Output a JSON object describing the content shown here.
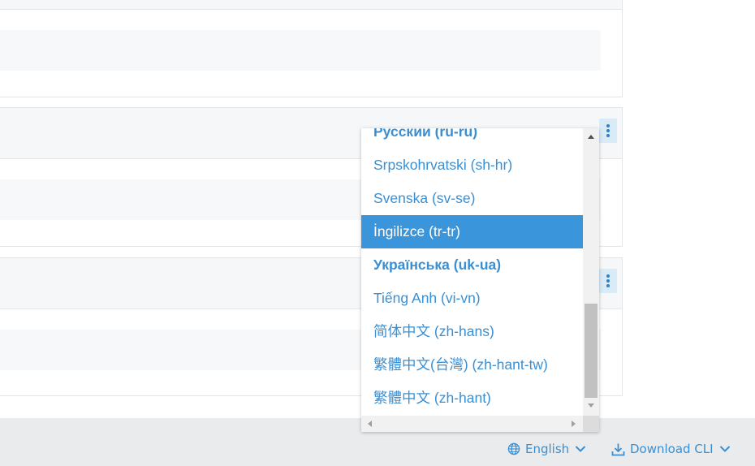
{
  "language_dropdown": {
    "items": [
      {
        "label": "Русский (ru-ru)",
        "bold": true,
        "selected": false
      },
      {
        "label": "Srpskohrvatski (sh-hr)",
        "bold": false,
        "selected": false
      },
      {
        "label": "Svenska (sv-se)",
        "bold": false,
        "selected": false
      },
      {
        "label": "İngilizce (tr-tr)",
        "bold": false,
        "selected": true
      },
      {
        "label": "Українська (uk-ua)",
        "bold": true,
        "selected": false
      },
      {
        "label": "Tiếng Anh (vi-vn)",
        "bold": false,
        "selected": false
      },
      {
        "label": "简体中文 (zh-hans)",
        "bold": false,
        "selected": false
      },
      {
        "label": "繁體中文(台灣) (zh-hant-tw)",
        "bold": false,
        "selected": false
      },
      {
        "label": "繁體中文 (zh-hant)",
        "bold": false,
        "selected": false
      }
    ]
  },
  "footer": {
    "language_label": "English",
    "download_label": "Download CLI"
  },
  "colors": {
    "accent": "#3a8fd2",
    "selected_bg": "#3a95da",
    "footer_bg": "#e9ebed"
  },
  "icons": {
    "language": "globe-icon",
    "download": "download-icon",
    "menu": "kebab-menu-icon"
  }
}
